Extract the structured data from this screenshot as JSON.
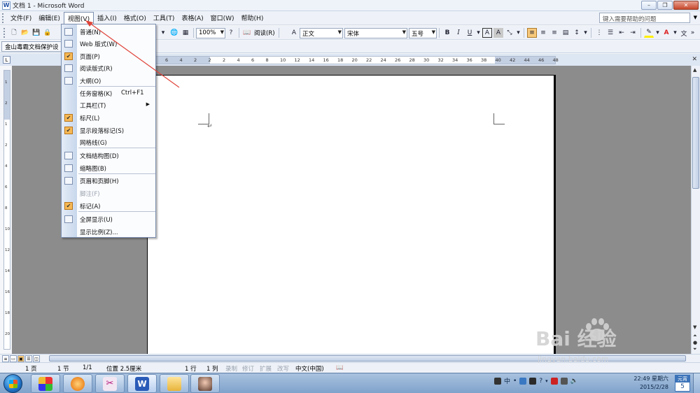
{
  "window": {
    "title": "文档 1 - Microsoft Word"
  },
  "menubar": {
    "items": [
      "文件(F)",
      "编辑(E)",
      "视图(V)",
      "插入(I)",
      "格式(O)",
      "工具(T)",
      "表格(A)",
      "窗口(W)",
      "帮助(H)"
    ],
    "help_placeholder": "键入需要帮助的问题"
  },
  "toolbar": {
    "zoom": "100%",
    "read_label": "阅读(R)",
    "style": "正文",
    "font": "宋体",
    "size": "五号",
    "bold": "B",
    "italic": "I",
    "underline": "U",
    "char_border": "A",
    "char_shade": "A"
  },
  "toolbar2": {
    "protect_label": "金山毒霸文档保护设"
  },
  "ruler": {
    "numbers": [
      "6",
      "4",
      "2",
      "2",
      "2",
      "4",
      "6",
      "8",
      "10",
      "12",
      "14",
      "16",
      "18",
      "20",
      "22",
      "24",
      "26",
      "28",
      "30",
      "32",
      "34",
      "36",
      "38",
      "40",
      "42",
      "44",
      "46",
      "48"
    ],
    "vertical_numbers": [
      "1",
      "2",
      "1",
      "2",
      "4",
      "6",
      "8",
      "10",
      "12",
      "14",
      "16",
      "18",
      "20"
    ]
  },
  "view_menu": {
    "items": [
      {
        "label": "普通(N)",
        "icon": "normal-view-icon",
        "checked": false
      },
      {
        "label": "Web 版式(W)",
        "icon": "web-layout-icon",
        "checked": false
      },
      {
        "label": "页面(P)",
        "icon": "print-layout-icon",
        "checked": true
      },
      {
        "label": "阅读版式(R)",
        "icon": "reading-layout-icon",
        "checked": false
      },
      {
        "label": "大纲(O)",
        "icon": "outline-view-icon",
        "checked": false
      },
      {
        "label": "任务窗格(K)",
        "shortcut": "Ctrl+F1"
      },
      {
        "label": "工具栏(T)",
        "submenu": true
      },
      {
        "label": "标尺(L)",
        "checked": true
      },
      {
        "label": "显示段落标记(S)",
        "checked": true
      },
      {
        "label": "网格线(G)"
      },
      {
        "label": "文档结构图(D)",
        "icon": "document-map-icon"
      },
      {
        "label": "缩略图(B)",
        "icon": "thumbnails-icon"
      },
      {
        "label": "页眉和页脚(H)",
        "icon": "header-footer-icon"
      },
      {
        "label": "脚注(F)",
        "disabled": true
      },
      {
        "label": "标记(A)",
        "icon": "markup-icon",
        "checked": true
      },
      {
        "label": "全屏显示(U)",
        "icon": "full-screen-icon"
      },
      {
        "label": "显示比例(Z)..."
      }
    ]
  },
  "statusbar": {
    "page": "1 页",
    "section": "1 节",
    "page_of": "1/1",
    "position": "位置 2.5厘米",
    "line": "1 行",
    "column": "1 列",
    "rec": "录制",
    "trk": "修订",
    "ext": "扩展",
    "ovr": "改写",
    "language": "中文(中国)"
  },
  "taskbar": {
    "ime": "中",
    "time": "22:49 星期六",
    "date": "2015/2/28",
    "cal_header": "元宵",
    "cal_day": "5"
  },
  "watermark": {
    "brand": "Bai 经验",
    "url": "jingyan.baidu.com"
  },
  "colors": {
    "accent": "#f7b955",
    "annotation_arrow": "#e0443a",
    "workspace": "#8c8c8c"
  }
}
